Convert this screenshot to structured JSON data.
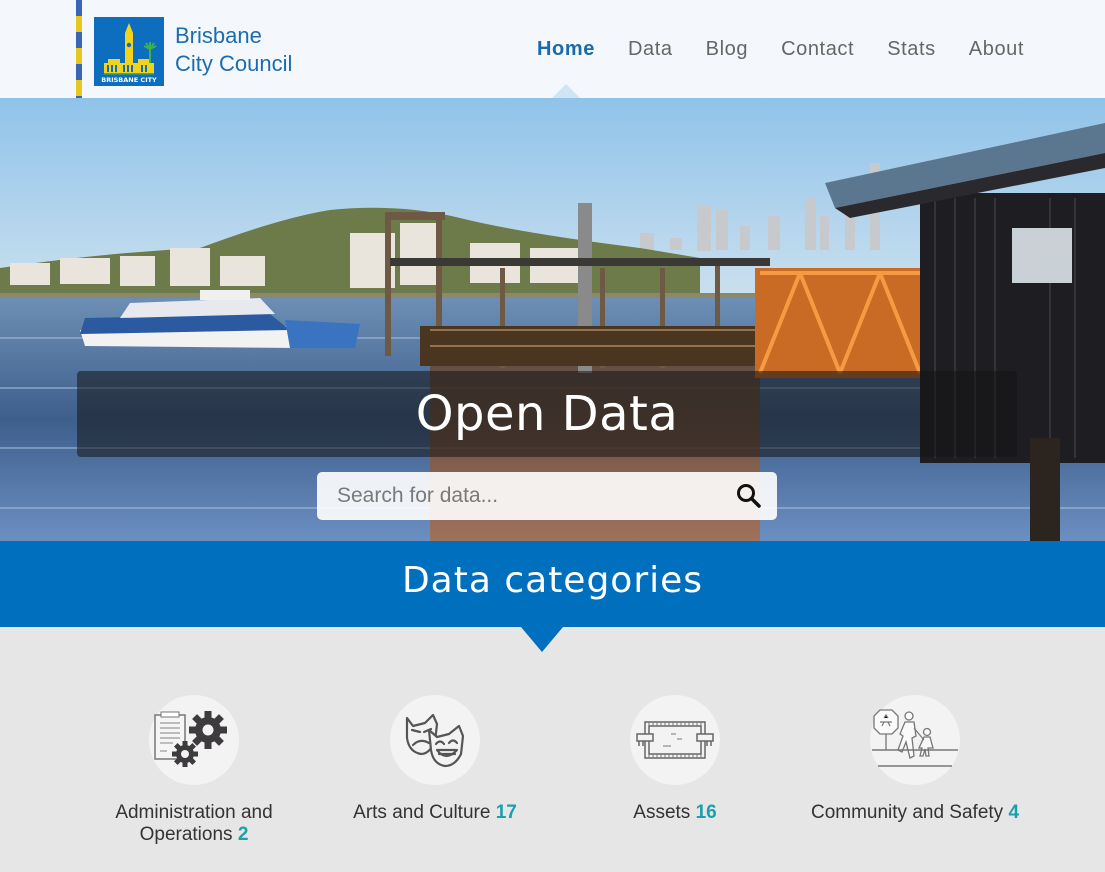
{
  "header": {
    "logo_text": "BRISBANE CITY",
    "brand_line1": "Brisbane",
    "brand_line2": "City Council",
    "nav": [
      {
        "label": "Home",
        "active": true
      },
      {
        "label": "Data",
        "active": false
      },
      {
        "label": "Blog",
        "active": false
      },
      {
        "label": "Contact",
        "active": false
      },
      {
        "label": "Stats",
        "active": false
      },
      {
        "label": "About",
        "active": false
      }
    ]
  },
  "hero": {
    "title": "Open Data",
    "search": {
      "placeholder": "Search for data...",
      "value": "",
      "icon": "search-icon"
    }
  },
  "categories": {
    "heading": "Data categories",
    "items": [
      {
        "name": "Administration and",
        "name2": "Operations",
        "count": "2",
        "icon": "clipboard-gears-icon"
      },
      {
        "name": "Arts and Culture",
        "count": "17",
        "icon": "theatre-masks-icon"
      },
      {
        "name": "Assets",
        "count": "16",
        "icon": "bridge-icon"
      },
      {
        "name": "Community and Safety",
        "count": "4",
        "icon": "school-crossing-icon"
      }
    ]
  },
  "colors": {
    "brand_blue": "#006fbd",
    "nav_active": "#1c6aa9",
    "count_teal": "#1aa0ac",
    "stripe_yellow": "#e8c81e",
    "stripe_blue": "#3a66b4"
  }
}
